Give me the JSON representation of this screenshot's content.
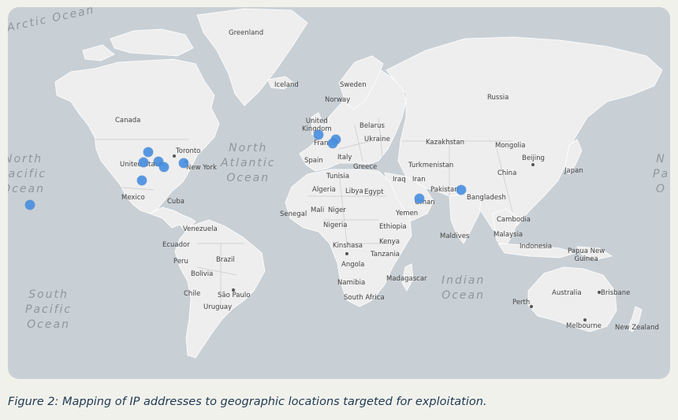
{
  "map": {
    "ocean_labels": [
      {
        "id": "arctic",
        "text": "Arctic Ocean"
      },
      {
        "id": "north-atlantic",
        "text": "North\nAtlantic\nOcean"
      },
      {
        "id": "north-pacific-west",
        "text": "North\nPacific\nOcean"
      },
      {
        "id": "north-pacific-east",
        "text": "N\nPa\nO"
      },
      {
        "id": "south-pacific",
        "text": "South\nPacific\nOcean"
      },
      {
        "id": "indian",
        "text": "Indian\nOcean"
      }
    ],
    "place_labels": [
      {
        "id": "greenland",
        "text": "Greenland"
      },
      {
        "id": "iceland",
        "text": "Iceland"
      },
      {
        "id": "sweden",
        "text": "Sweden"
      },
      {
        "id": "norway",
        "text": "Norway"
      },
      {
        "id": "russia",
        "text": "Russia"
      },
      {
        "id": "canada",
        "text": "Canada"
      },
      {
        "id": "united-kingdom",
        "text": "United\nKingdom"
      },
      {
        "id": "belarus",
        "text": "Belarus"
      },
      {
        "id": "ukraine",
        "text": "Ukraine"
      },
      {
        "id": "france",
        "text": "France"
      },
      {
        "id": "kazakhstan",
        "text": "Kazakhstan"
      },
      {
        "id": "mongolia",
        "text": "Mongolia"
      },
      {
        "id": "toronto",
        "text": "Toronto"
      },
      {
        "id": "united-states",
        "text": "United States"
      },
      {
        "id": "new-york",
        "text": "New York"
      },
      {
        "id": "spain",
        "text": "Spain"
      },
      {
        "id": "italy",
        "text": "Italy"
      },
      {
        "id": "greece",
        "text": "Greece"
      },
      {
        "id": "turkmenistan",
        "text": "Turkmenistan"
      },
      {
        "id": "beijing",
        "text": "Beijing"
      },
      {
        "id": "japan",
        "text": "Japan"
      },
      {
        "id": "china",
        "text": "China"
      },
      {
        "id": "tunisia",
        "text": "Tunisia"
      },
      {
        "id": "iraq",
        "text": "Iraq"
      },
      {
        "id": "iran",
        "text": "Iran"
      },
      {
        "id": "pakistan",
        "text": "Pakistan"
      },
      {
        "id": "mexico",
        "text": "Mexico"
      },
      {
        "id": "algeria",
        "text": "Algeria"
      },
      {
        "id": "libya",
        "text": "Libya"
      },
      {
        "id": "egypt",
        "text": "Egypt"
      },
      {
        "id": "bangladesh",
        "text": "Bangladesh"
      },
      {
        "id": "cuba",
        "text": "Cuba"
      },
      {
        "id": "oman",
        "text": "Oman"
      },
      {
        "id": "senegal",
        "text": "Senegal"
      },
      {
        "id": "mali",
        "text": "Mali"
      },
      {
        "id": "niger",
        "text": "Niger"
      },
      {
        "id": "yemen",
        "text": "Yemen"
      },
      {
        "id": "cambodia",
        "text": "Cambodia"
      },
      {
        "id": "nigeria",
        "text": "Nigeria"
      },
      {
        "id": "ethiopia",
        "text": "Ethiopia"
      },
      {
        "id": "venezuela",
        "text": "Venezuela"
      },
      {
        "id": "malaysia",
        "text": "Malaysia"
      },
      {
        "id": "maldives",
        "text": "Maldives"
      },
      {
        "id": "ecuador",
        "text": "Ecuador"
      },
      {
        "id": "kinshasa",
        "text": "Kinshasa"
      },
      {
        "id": "kenya",
        "text": "Kenya"
      },
      {
        "id": "indonesia",
        "text": "Indonesia"
      },
      {
        "id": "tanzania",
        "text": "Tanzania"
      },
      {
        "id": "papua-new-guinea",
        "text": "Papua New\nGuinea"
      },
      {
        "id": "peru",
        "text": "Peru"
      },
      {
        "id": "brazil",
        "text": "Brazil"
      },
      {
        "id": "angola",
        "text": "Angola"
      },
      {
        "id": "bolivia",
        "text": "Bolivia"
      },
      {
        "id": "madagascar",
        "text": "Madagascar"
      },
      {
        "id": "namibia",
        "text": "Namibia"
      },
      {
        "id": "chile",
        "text": "Chile"
      },
      {
        "id": "sao-paulo",
        "text": "São Paulo"
      },
      {
        "id": "australia",
        "text": "Australia"
      },
      {
        "id": "brisbane",
        "text": "Brisbane"
      },
      {
        "id": "south-africa",
        "text": "South Africa"
      },
      {
        "id": "perth",
        "text": "Perth"
      },
      {
        "id": "uruguay",
        "text": "Uruguay"
      },
      {
        "id": "melbourne",
        "text": "Melbourne"
      },
      {
        "id": "new-zealand",
        "text": "New Zealand"
      }
    ],
    "marker_color": "#4a90e2",
    "ocean_color": "#c9d0d5",
    "land_color": "#eeeeee",
    "markers": [
      {
        "id": "hawaii"
      },
      {
        "id": "us-north-central"
      },
      {
        "id": "us-central-west"
      },
      {
        "id": "us-central"
      },
      {
        "id": "us-great-lakes"
      },
      {
        "id": "us-east"
      },
      {
        "id": "us-south"
      },
      {
        "id": "uk"
      },
      {
        "id": "europe-1"
      },
      {
        "id": "europe-2"
      },
      {
        "id": "oman"
      },
      {
        "id": "india"
      }
    ]
  },
  "caption": "Figure 2: Mapping of IP addresses to geographic locations targeted for exploitation."
}
